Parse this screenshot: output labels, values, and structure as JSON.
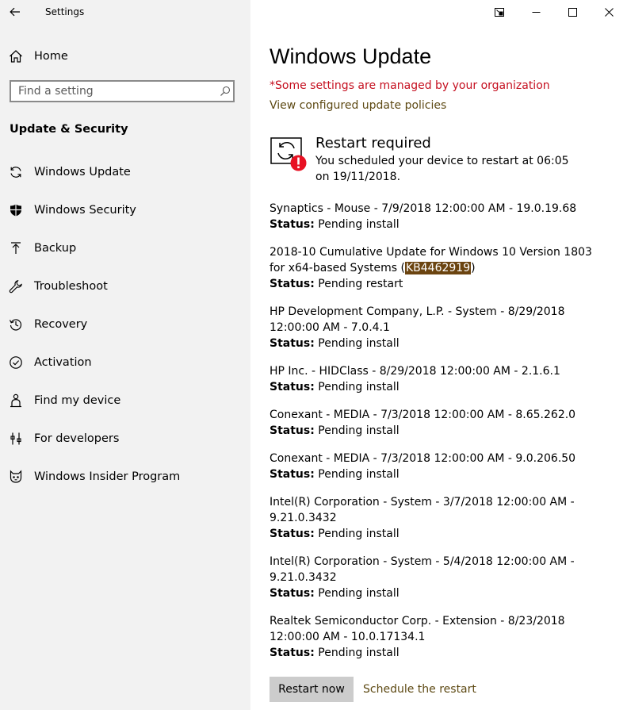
{
  "window": {
    "app_title": "Settings"
  },
  "sidebar": {
    "home_label": "Home",
    "search_placeholder": "Find a setting",
    "section_heading": "Update & Security",
    "items": [
      {
        "label": "Windows Update",
        "icon": "sync-icon"
      },
      {
        "label": "Windows Security",
        "icon": "shield-icon"
      },
      {
        "label": "Backup",
        "icon": "upload-arrow-icon"
      },
      {
        "label": "Troubleshoot",
        "icon": "wrench-icon"
      },
      {
        "label": "Recovery",
        "icon": "history-icon"
      },
      {
        "label": "Activation",
        "icon": "checkmark-circle-icon"
      },
      {
        "label": "Find my device",
        "icon": "person-location-icon"
      },
      {
        "label": "For developers",
        "icon": "developer-tools-icon"
      },
      {
        "label": "Windows Insider Program",
        "icon": "insider-cat-icon"
      }
    ]
  },
  "main": {
    "page_title": "Windows Update",
    "managed_notice": "*Some settings are managed by your organization",
    "policies_link": "View configured update policies",
    "restart": {
      "title": "Restart required",
      "description": "You scheduled your device to restart at 06:05 on 19/11/2018."
    },
    "status_label": "Status:",
    "updates": [
      {
        "name": "Synaptics - Mouse - 7/9/2018 12:00:00 AM - 19.0.19.68",
        "status": "Pending install"
      },
      {
        "name_before": "2018-10 Cumulative Update for Windows 10 Version 1803 for x64-based Systems (",
        "kb": "KB4462919",
        "name_after": ")",
        "status": "Pending restart"
      },
      {
        "name": "HP Development Company, L.P. - System - 8/29/2018 12:00:00 AM - 7.0.4.1",
        "status": "Pending install"
      },
      {
        "name": "HP Inc. - HIDClass - 8/29/2018 12:00:00 AM - 2.1.6.1",
        "status": "Pending install"
      },
      {
        "name": "Conexant - MEDIA - 7/3/2018 12:00:00 AM - 8.65.262.0",
        "status": "Pending install"
      },
      {
        "name": "Conexant - MEDIA - 7/3/2018 12:00:00 AM - 9.0.206.50",
        "status": "Pending install"
      },
      {
        "name": "Intel(R) Corporation - System - 3/7/2018 12:00:00 AM - 9.21.0.3432",
        "status": "Pending install"
      },
      {
        "name": "Intel(R) Corporation - System - 5/4/2018 12:00:00 AM - 9.21.0.3432",
        "status": "Pending install"
      },
      {
        "name": "Realtek Semiconductor Corp. - Extension - 8/23/2018 12:00:00 AM - 10.0.17134.1",
        "status": "Pending install"
      }
    ],
    "restart_now_label": "Restart now",
    "schedule_restart_label": "Schedule the restart"
  },
  "colors": {
    "sidebar_bg": "#f2f2f2",
    "warning_red": "#c50f1f",
    "link_brown": "#5e4a14",
    "highlight_bg": "#6b4410",
    "button_gray": "#cccccc"
  }
}
